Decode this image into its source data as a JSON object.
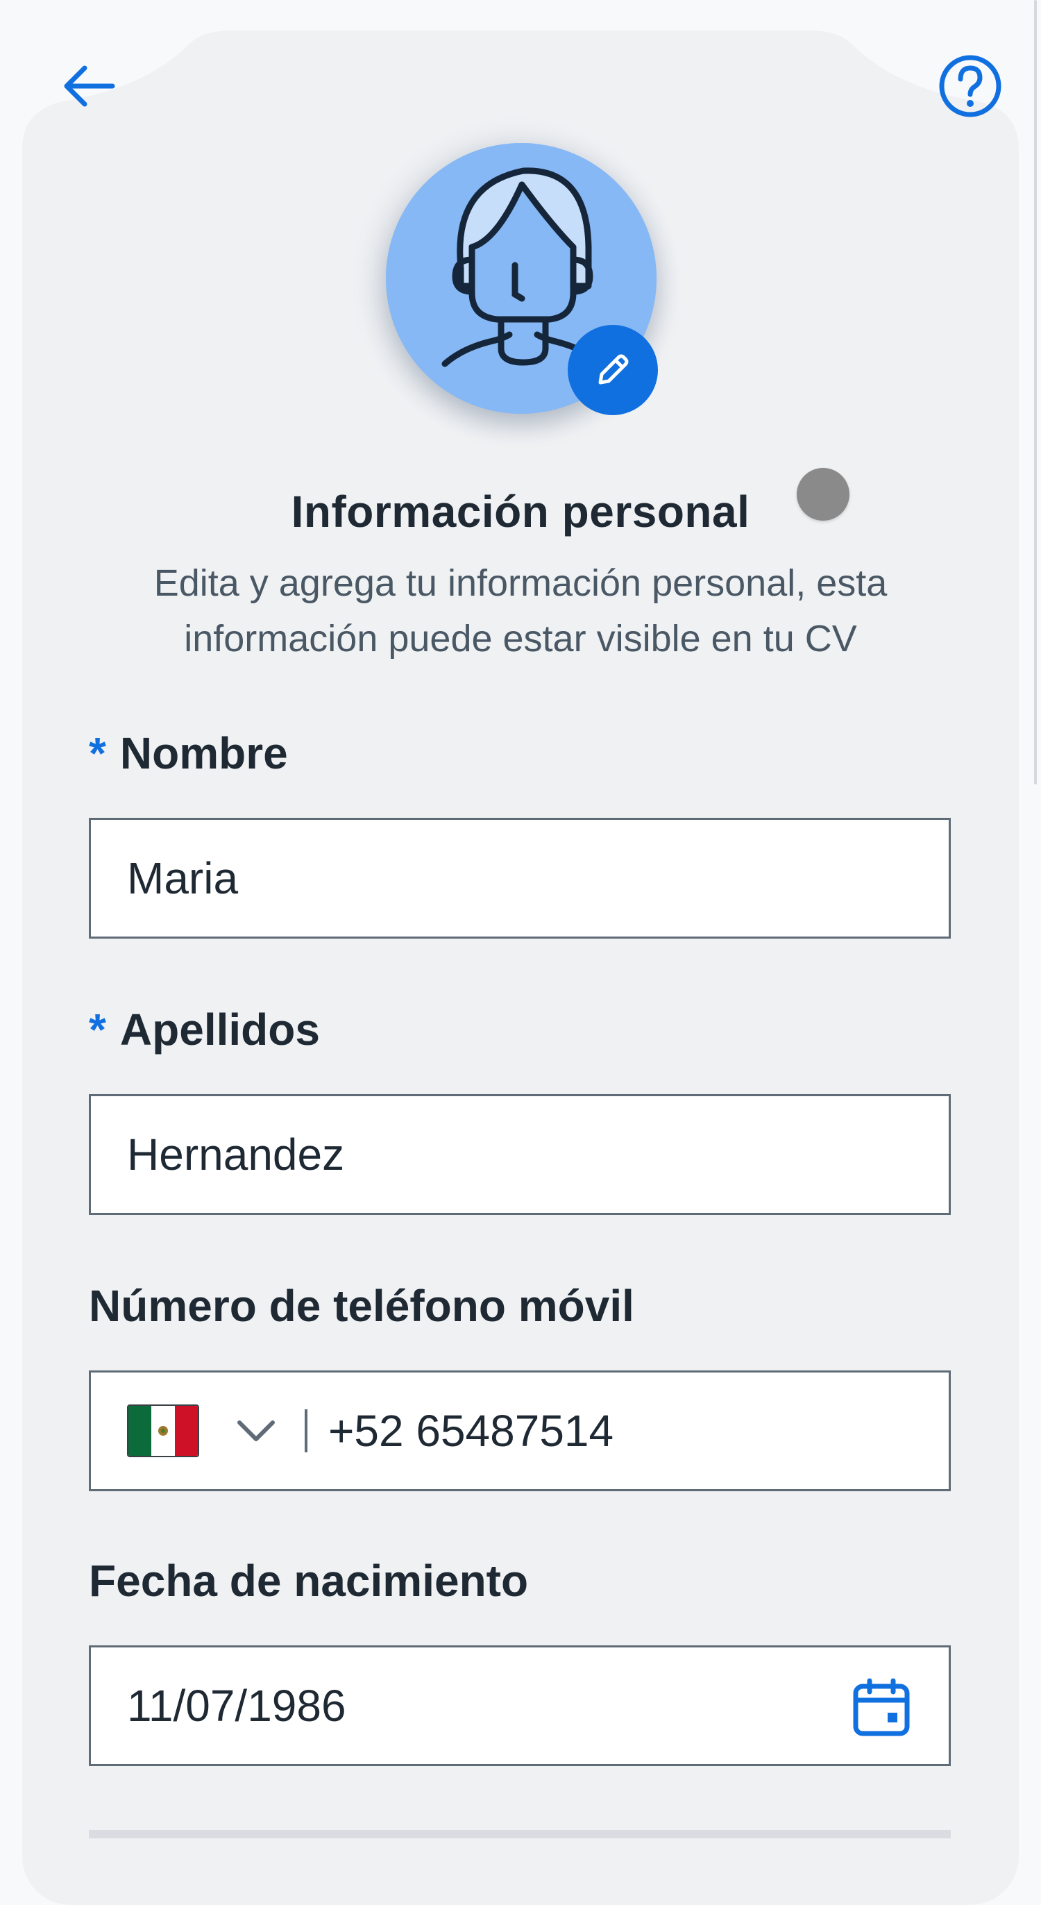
{
  "header": {
    "back_icon": "arrow-left-icon",
    "help_icon": "question-circle-icon",
    "accent_color": "#1170e0"
  },
  "profile": {
    "avatar_icon": "person-avatar-icon",
    "edit_icon": "pencil-icon",
    "title": "Información personal",
    "description": "Edita y agrega tu información personal, esta información puede estar visible en tu CV"
  },
  "form": {
    "required_mark": "*",
    "nombre": {
      "label": "Nombre",
      "value": "Maria"
    },
    "apellidos": {
      "label": "Apellidos",
      "value": "Hernandez"
    },
    "telefono": {
      "label": "Número de teléfono móvil",
      "country_flag": "mexico-flag-icon",
      "value": "+52 65487514"
    },
    "fecha": {
      "label": "Fecha de nacimiento",
      "value": "11/07/1986",
      "icon": "calendar-icon"
    }
  }
}
